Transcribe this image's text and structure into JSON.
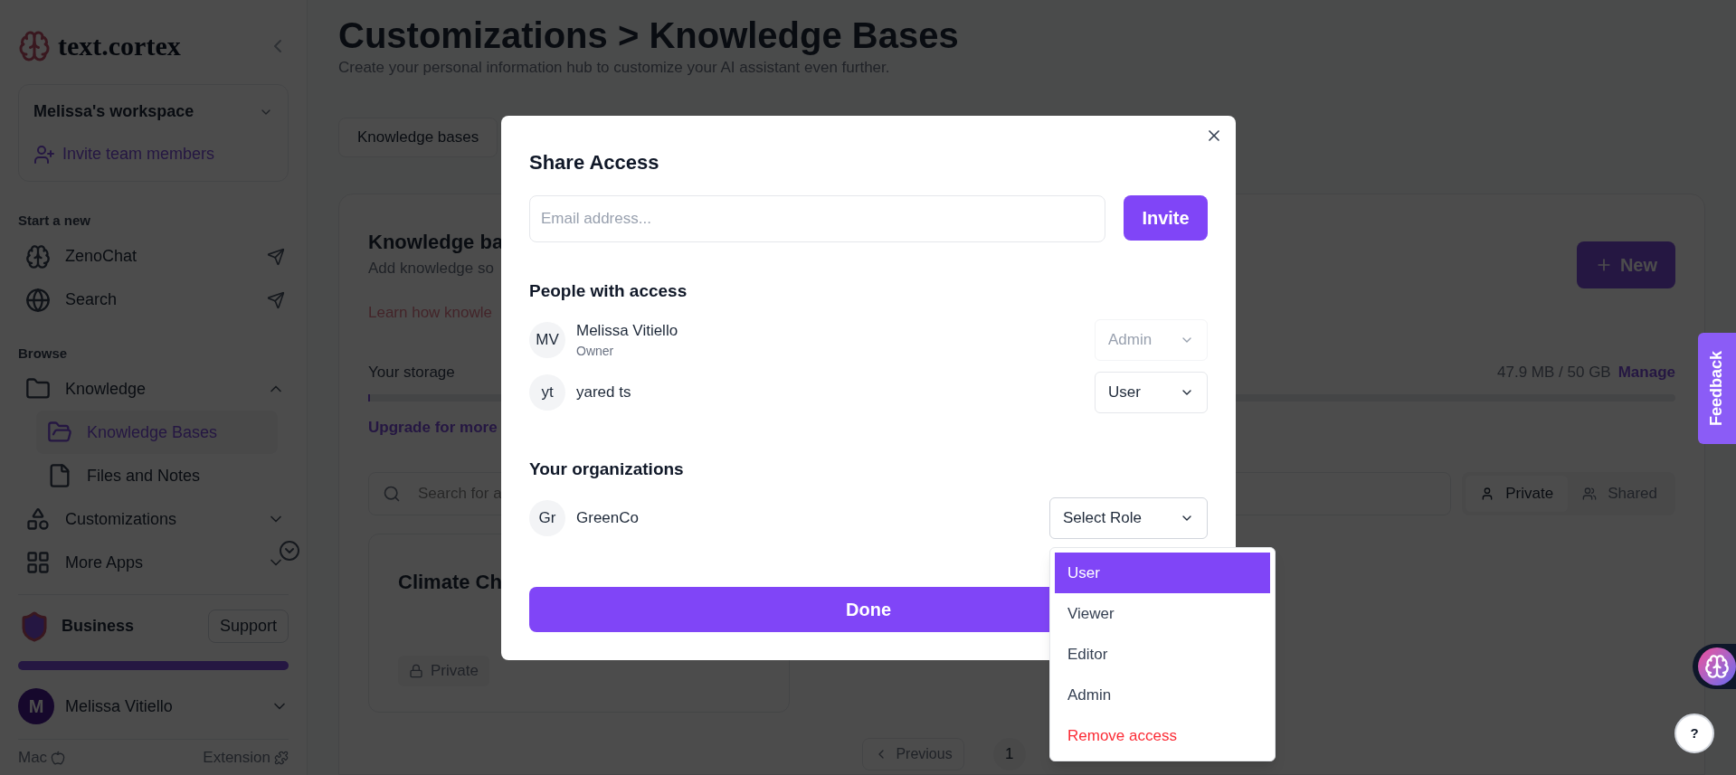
{
  "sidebar": {
    "logo": "text.cortex",
    "workspace": {
      "name": "Melissa's workspace",
      "invite": "Invite team members"
    },
    "start_heading": "Start a new",
    "start_items": [
      {
        "label": "ZenoChat"
      },
      {
        "label": "Search"
      }
    ],
    "browse_heading": "Browse",
    "browse_items": [
      {
        "label": "Knowledge",
        "selected": false,
        "expanded": true,
        "children": [
          {
            "label": "Knowledge Bases",
            "selected": true
          },
          {
            "label": "Files and Notes",
            "selected": false
          }
        ]
      },
      {
        "label": "Customizations",
        "selected": false,
        "expanded": false
      },
      {
        "label": "More Apps",
        "selected": false,
        "expanded": false
      }
    ],
    "plan": {
      "name": "Business",
      "support": "Support",
      "level": 1
    },
    "user": {
      "initial": "M",
      "name": "Melissa Vitiello"
    },
    "footer": {
      "left": "Mac",
      "right": "Extension"
    }
  },
  "page": {
    "title": "Customizations > Knowledge Bases",
    "subtitle": "Create your personal information hub to customize your AI assistant even further.",
    "tabs": [
      {
        "label": "Knowledge bases",
        "selected": true
      }
    ],
    "card": {
      "title": "Knowledge ba",
      "description": "Add knowledge so",
      "learn_link": "Learn how knowle",
      "new_button": "New",
      "storage_label": "Your storage",
      "storage_value": "47.9 MB / 50 GB",
      "manage": "Manage",
      "storage": {
        "level": 0.001
      },
      "upgrade": "Upgrade for more",
      "search": {
        "placeholder": "Search for a"
      },
      "filters": [
        {
          "label": "Private",
          "selected": true
        },
        {
          "label": "Shared",
          "selected": false
        }
      ],
      "items": [
        {
          "title": "Climate Ch",
          "tag": "Private"
        }
      ],
      "pagination": {
        "previous": "Previous",
        "pages": [
          {
            "label": "1",
            "selected": true
          }
        ]
      }
    }
  },
  "modal": {
    "title": "Share Access",
    "email": {
      "placeholder": "Email address..."
    },
    "invite": "Invite",
    "people_heading": "People with access",
    "people": [
      {
        "initials": "MV",
        "name": "Melissa Vitiello",
        "role_note": "Owner",
        "role": "Admin",
        "disabled": true
      },
      {
        "initials": "yt",
        "name": "yared ts",
        "role": "User",
        "disabled": false
      }
    ],
    "org_heading": "Your organizations",
    "orgs": [
      {
        "initials": "Gr",
        "name": "GreenCo",
        "role": "Select Role",
        "expanded": true
      }
    ],
    "done": "Done"
  },
  "role_menu": [
    {
      "label": "User",
      "kind": "option",
      "selected": true
    },
    {
      "label": "Viewer",
      "kind": "option",
      "selected": false
    },
    {
      "label": "Editor",
      "kind": "option",
      "selected": false
    },
    {
      "label": "Admin",
      "kind": "option",
      "selected": false
    },
    {
      "label": "Remove access",
      "kind": "danger",
      "selected": false
    }
  ],
  "feedback": "Feedback",
  "help": "?"
}
